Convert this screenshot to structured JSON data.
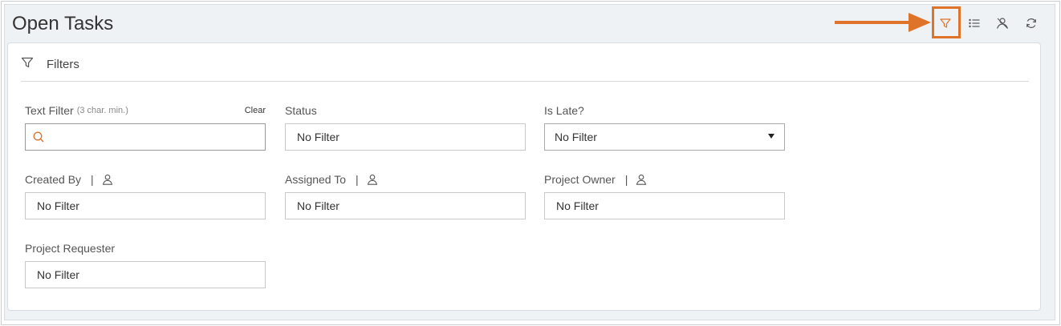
{
  "page": {
    "title": "Open Tasks"
  },
  "toolbar": {
    "icons": [
      "filter-icon",
      "list-icon",
      "people-icon",
      "refresh-icon"
    ],
    "active_color": "#e0732a"
  },
  "filters_panel": {
    "title": "Filters",
    "text_filter": {
      "label": "Text Filter",
      "hint": "(3 char. min.)",
      "clear_label": "Clear",
      "value": "",
      "placeholder": ""
    },
    "status": {
      "label": "Status",
      "value": "No Filter"
    },
    "is_late": {
      "label": "Is Late?",
      "value": "No Filter"
    },
    "created_by": {
      "label": "Created By",
      "sep": "|",
      "value": "No Filter"
    },
    "assigned_to": {
      "label": "Assigned To",
      "sep": "|",
      "value": "No Filter"
    },
    "project_owner": {
      "label": "Project Owner",
      "sep": "|",
      "value": "No Filter"
    },
    "project_requester": {
      "label": "Project Requester",
      "value": "No Filter"
    }
  },
  "annotation": {
    "color": "#e0732a"
  }
}
